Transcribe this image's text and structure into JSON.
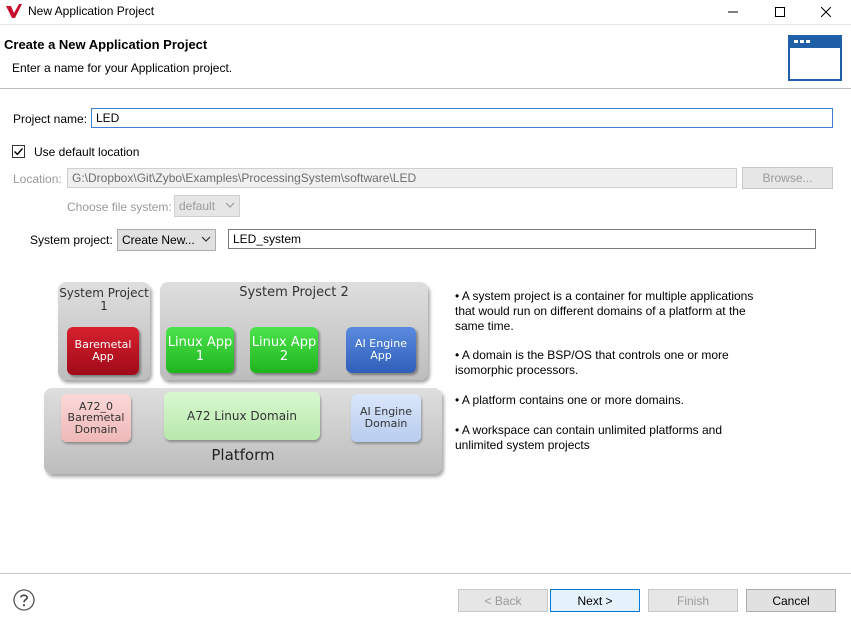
{
  "window": {
    "title": "New Application Project"
  },
  "header": {
    "title": "Create a New Application Project",
    "description": "Enter a name for your Application project."
  },
  "form": {
    "project_name_label": "Project name:",
    "project_name_value": "LED",
    "use_default_location_label": "Use default location",
    "use_default_location_checked": true,
    "location_label": "Location:",
    "location_value": "G:\\Dropbox\\Git\\Zybo\\Examples\\ProcessingSystem\\software\\LED",
    "browse_label": "Browse...",
    "file_system_label": "Choose file system:",
    "file_system_value": "default",
    "system_project_label": "System project:",
    "system_project_option": "Create New...",
    "system_project_name": "LED_system"
  },
  "diagram": {
    "system_project_1": "System Project 1",
    "system_project_2": "System Project 2",
    "baremetal_app": "Baremetal App",
    "linux_app_1": "Linux App 1",
    "linux_app_2": "Linux App 2",
    "ai_engine_app": "AI Engine App",
    "a72_baremetal_domain": "A72_0 Baremetal Domain",
    "a72_linux_domain": "A72 Linux Domain",
    "ai_engine_domain": "AI Engine Domain",
    "platform": "Platform"
  },
  "bullets": [
    "• A system project is a container for multiple applications that would run on different domains of a platform at the same time.",
    "• A domain is the BSP/OS that controls one or more isomorphic processors.",
    "• A platform contains one or more domains.",
    "• A workspace can contain unlimited platforms and unlimited system projects"
  ],
  "footer": {
    "back_label": "< Back",
    "next_label": "Next >",
    "finish_label": "Finish",
    "cancel_label": "Cancel"
  },
  "colors": {
    "accent": "#0078d7",
    "baremetal_app": "#c8102e",
    "linux_app": "#2ecc2e",
    "ai_engine_app": "#3f6fc8",
    "baremetal_domain": "#f5c8c8",
    "linux_domain": "#c9f2c0",
    "ai_engine_domain": "#c9d9f5"
  },
  "icons": [
    "app-logo-icon",
    "minimize-icon",
    "maximize-icon",
    "close-icon",
    "wizard-window-icon",
    "checkbox-check-icon",
    "dropdown-arrow-icon",
    "help-icon"
  ]
}
